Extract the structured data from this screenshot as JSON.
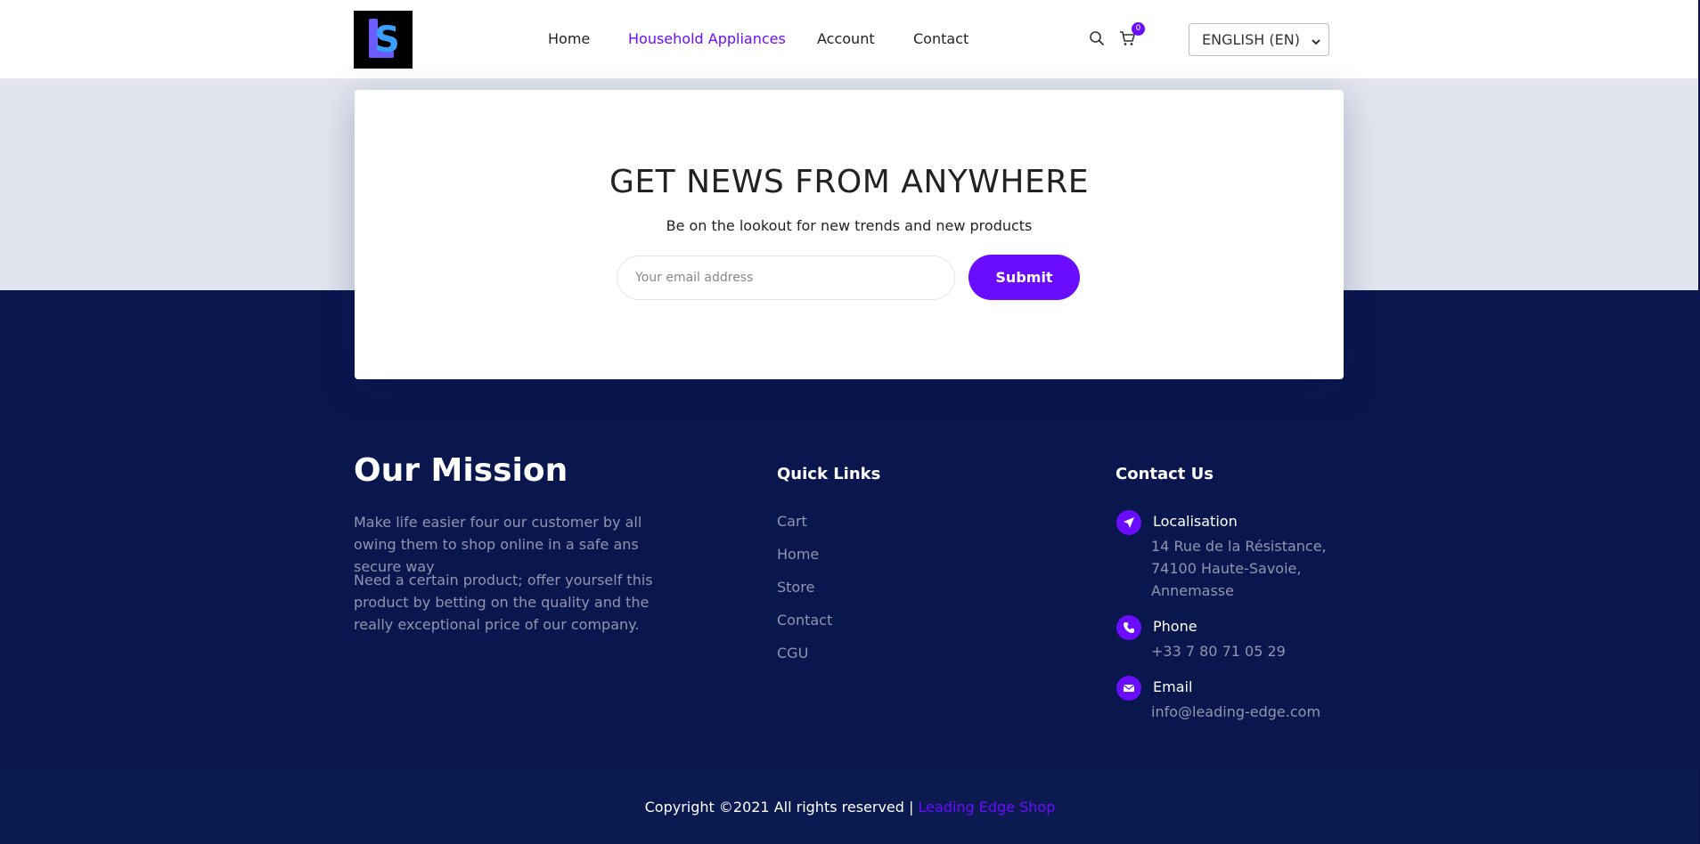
{
  "header": {
    "nav": [
      {
        "label": "Home",
        "active": false
      },
      {
        "label": "Household Appliances",
        "active": true
      },
      {
        "label": "Account",
        "active": false
      },
      {
        "label": "Contact",
        "active": false
      }
    ],
    "cart_count": "0",
    "language": "ENGLISH (EN)",
    "icons": [
      "search-icon",
      "cart-icon",
      "chevron-down-icon"
    ]
  },
  "newsletter": {
    "title": "GET NEWS FROM ANYWHERE",
    "subtitle": "Be on the lookout for new trends and new products",
    "email_placeholder": "Your email address",
    "submit_label": "Submit"
  },
  "footer": {
    "mission": {
      "title": "Our Mission",
      "p1": "Make life easier four our customer by all owing them to shop online in a safe ans secure way",
      "p2": "Need a certain product; offer yourself this product by betting on the quality and the really exceptional price of our company."
    },
    "quick_links": {
      "title": "Quick Links",
      "items": [
        "Cart",
        "Home",
        "Store",
        "Contact",
        "CGU"
      ]
    },
    "contact": {
      "title": "Contact Us",
      "localisation_label": "Localisation",
      "localisation_value": "14 Rue de la Résistance, 74100 Haute-Savoie, Annemasse",
      "phone_label": "Phone",
      "phone_value": "+33 7 80 71 05 29",
      "email_label": "Email",
      "email_value": "info@leading-edge.com"
    },
    "copyright": "Copyright ©2021 All rights reserved | ",
    "brand": "Leading Edge Shop"
  },
  "colors": {
    "accent": "#6a0dff",
    "footer_bg": "#0a174e",
    "band_bg": "#e2e5ef"
  }
}
